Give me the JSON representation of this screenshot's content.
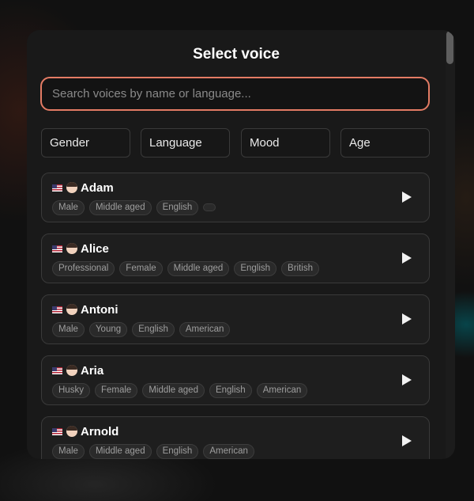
{
  "modal": {
    "title": "Select voice",
    "search_placeholder": "Search voices by name or language..."
  },
  "filters": [
    "Gender",
    "Language",
    "Mood",
    "Age"
  ],
  "voices": [
    {
      "name": "Adam",
      "tags": [
        "Male",
        "Middle aged",
        "English",
        ""
      ]
    },
    {
      "name": "Alice",
      "tags": [
        "Professional",
        "Female",
        "Middle aged",
        "English",
        "British"
      ]
    },
    {
      "name": "Antoni",
      "tags": [
        "Male",
        "Young",
        "English",
        "American"
      ]
    },
    {
      "name": "Aria",
      "tags": [
        "Husky",
        "Female",
        "Middle aged",
        "English",
        "American"
      ]
    },
    {
      "name": "Arnold",
      "tags": [
        "Male",
        "Middle aged",
        "English",
        "American"
      ]
    }
  ],
  "colors": {
    "accent": "#e37b64",
    "modal_bg": "#191919",
    "card_bg": "#1e1e1e"
  },
  "icons": {
    "flag": "us-flag-icon",
    "avatar": "person-avatar-icon",
    "play": "play-icon"
  }
}
